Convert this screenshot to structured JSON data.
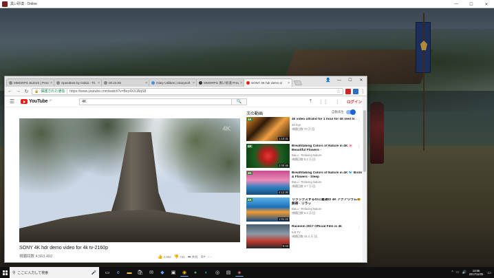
{
  "game_window": {
    "title": "黒い砂漠 - Online",
    "controls": [
      "—",
      "☐",
      "✕"
    ]
  },
  "chrome": {
    "tabs": [
      {
        "label": "MMORPG BLESS | Previ",
        "active": false
      },
      {
        "label": "Speedtest by Ookla - Th",
        "active": false
      },
      {
        "label": "00:24:06",
        "active": false
      },
      {
        "label": "Glary Utilities | Glarysoft",
        "active": false
      },
      {
        "label": "MMORPG 黒い砂漠 Previ",
        "active": false
      },
      {
        "label": "SONY 4K hdr demo vi",
        "active": true
      }
    ],
    "window_controls": [
      "—",
      "☐",
      "✕"
    ],
    "toolbar": {
      "secure_label": "保護された通信",
      "url": "https://www.youtube.com/watch?v=Bey4XXJAqS8"
    }
  },
  "youtube": {
    "logo": "YouTube",
    "logo_region": "JP",
    "search_value": "4K",
    "login_label": "ログイン",
    "watermark": "4K",
    "video": {
      "title": "SONY 4K hdr demo video for 4k tv-2160p",
      "views": "視聴回数 4,563,492",
      "likes": "2,902",
      "dislikes": "721",
      "share_label": "共有"
    },
    "sidebar": {
      "heading": "次の動画",
      "autoplay_label": "自動再生",
      "items": [
        {
          "title": "4k video ultrahd for 1 hour for 4k oled tv",
          "channel": "4K Eye",
          "views": "視聴回数 70 万 回",
          "duration": "1:10:31",
          "badge": "4K"
        },
        {
          "title": "Breathtaking Colors of Nature in 4K 🌸 Beautiful Flowers -",
          "channel": "BaLu - Relaxing Nature",
          "views": "視聴回数 6.3 万 回",
          "duration": "2:00:46",
          "badge": "4K"
        },
        {
          "title": "Breathtaking Colors of Nature in 4K 🐦 Birds & Flowers - Sleep",
          "channel": "BaLu - Relaxing Nature",
          "views": "視聴回数 4.7 万 回",
          "duration": "4:12:30",
          "badge": "4K"
        },
        {
          "title": "リラックスするのに最適の 4K アクアリウム🐠 熱帯 · リラッ",
          "channel": "BaLu - Relaxing Nature",
          "views": "視聴回数 5.4 万 回",
          "duration": "1:01:22",
          "badge": "4K"
        },
        {
          "title": "Raceism 2017 Official Film in 4k",
          "channel": "ILB TV",
          "views": "視聴回数 44.4 万 回",
          "duration": "5:03",
          "badge": ""
        }
      ]
    }
  },
  "taskbar": {
    "search_placeholder": "ここに入力して検索",
    "clock_time": "13:55",
    "clock_date": "2017/11/05"
  }
}
